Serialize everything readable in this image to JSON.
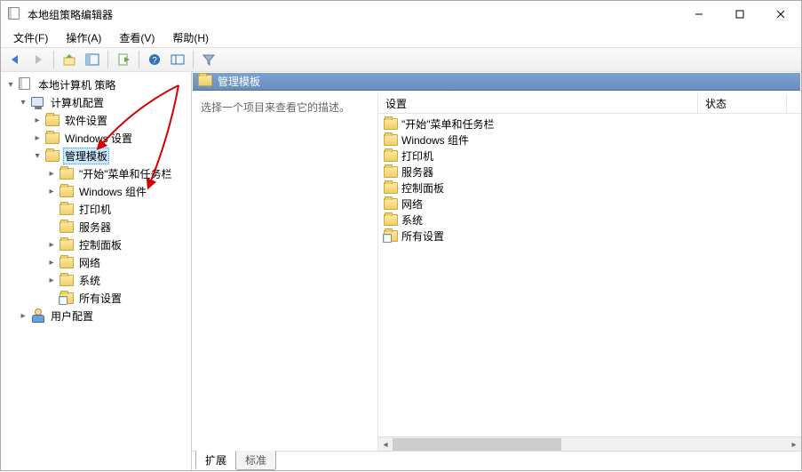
{
  "window": {
    "title": "本地组策略编辑器"
  },
  "menubar": {
    "items": [
      "文件(F)",
      "操作(A)",
      "查看(V)",
      "帮助(H)"
    ]
  },
  "tree": {
    "root": {
      "label": "本地计算机 策略"
    },
    "computer_config": {
      "label": "计算机配置"
    },
    "software_settings": {
      "label": "软件设置"
    },
    "windows_settings": {
      "label": "Windows 设置"
    },
    "admin_templates": {
      "label": "管理模板"
    },
    "start_taskbar": {
      "label": "\"开始\"菜单和任务栏"
    },
    "win_components": {
      "label": "Windows 组件"
    },
    "printers": {
      "label": "打印机"
    },
    "servers": {
      "label": "服务器"
    },
    "control_panel": {
      "label": "控制面板"
    },
    "network": {
      "label": "网络"
    },
    "system": {
      "label": "系统"
    },
    "all_settings": {
      "label": "所有设置"
    },
    "user_config": {
      "label": "用户配置"
    }
  },
  "right": {
    "header": "管理模板",
    "description_prompt": "选择一个项目来查看它的描述。",
    "columns": {
      "settings": "设置",
      "status": "状态"
    },
    "items": [
      {
        "label": "\"开始\"菜单和任务栏",
        "kind": "folder"
      },
      {
        "label": "Windows 组件",
        "kind": "folder"
      },
      {
        "label": "打印机",
        "kind": "folder"
      },
      {
        "label": "服务器",
        "kind": "folder"
      },
      {
        "label": "控制面板",
        "kind": "folder"
      },
      {
        "label": "网络",
        "kind": "folder"
      },
      {
        "label": "系统",
        "kind": "folder"
      },
      {
        "label": "所有设置",
        "kind": "ext"
      }
    ]
  },
  "tabs": {
    "extended": "扩展",
    "standard": "标准"
  }
}
